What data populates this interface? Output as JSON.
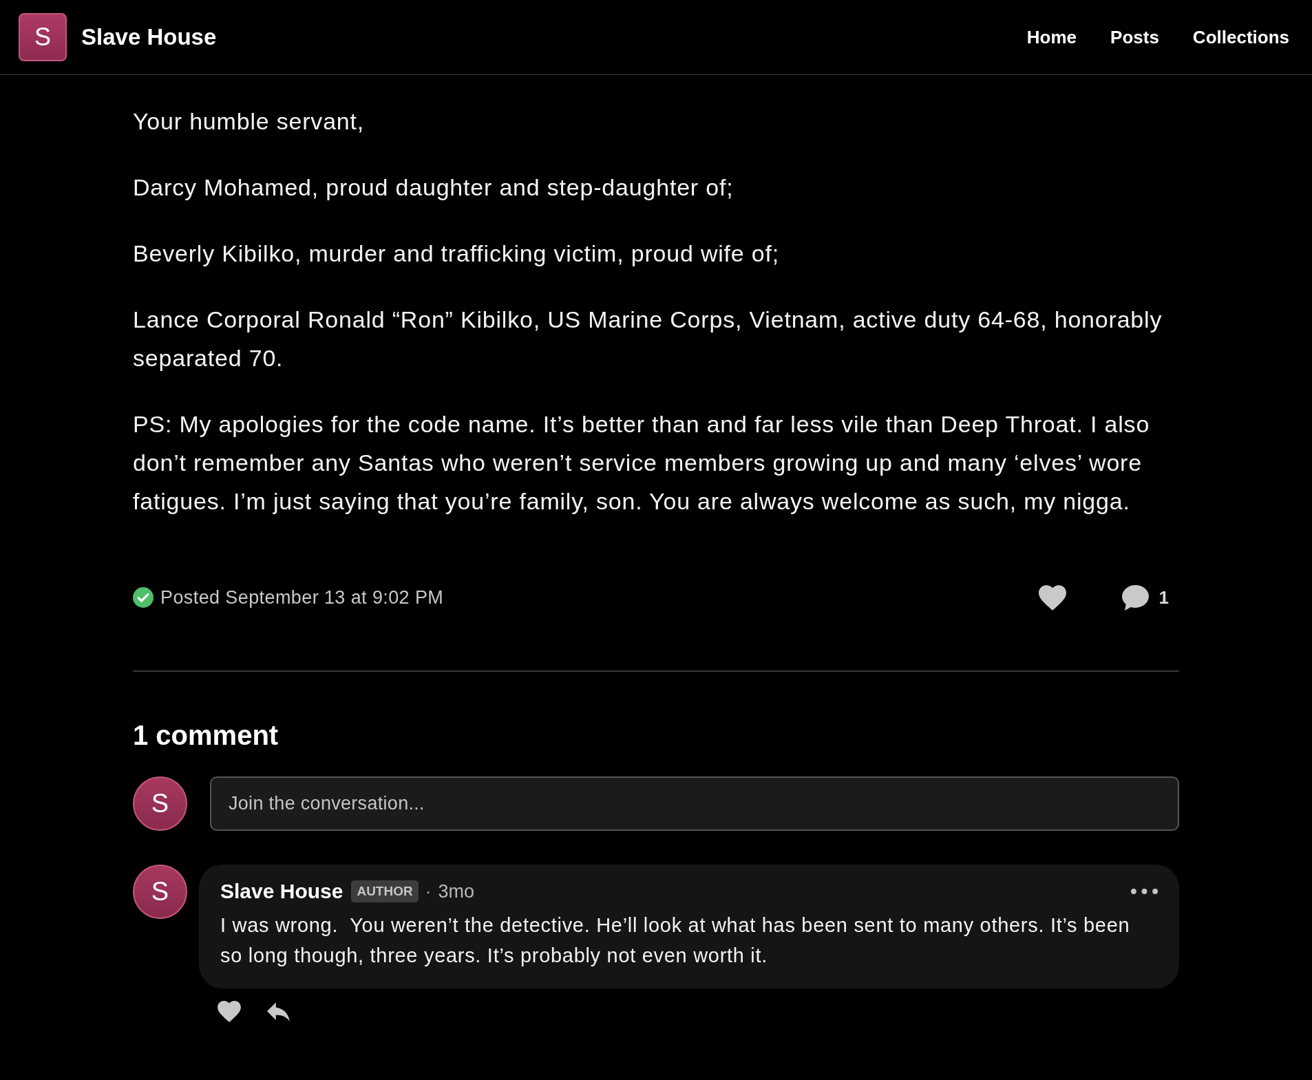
{
  "header": {
    "logo_letter": "S",
    "site_name": "Slave House",
    "nav": [
      {
        "label": "Home"
      },
      {
        "label": "Posts"
      },
      {
        "label": "Collections"
      }
    ]
  },
  "post": {
    "paragraphs": [
      "Your humble servant,",
      "Darcy Mohamed, proud daughter and step-daughter of;",
      "Beverly Kibilko, murder and trafficking victim, proud wife of;",
      "Lance Corporal Ronald “Ron” Kibilko, US Marine Corps, Vietnam, active duty 64-68, honorably separated 70.",
      "PS: My apologies for the code name. It’s better than and far less vile than Deep Throat. I also don’t remember any Santas who weren’t service members growing up and many ‘elves’ wore fatigues. I’m just saying that you’re family, son. You are always welcome as such, my nigga."
    ],
    "posted": "Posted September 13 at 9:02 PM",
    "comment_count": "1"
  },
  "comments_section": {
    "heading": "1 comment",
    "composer": {
      "avatar_letter": "S",
      "placeholder": "Join the conversation..."
    },
    "comments": [
      {
        "avatar_letter": "S",
        "author": "Slave House",
        "badge": "AUTHOR",
        "separator": "·",
        "time": "3mo",
        "text": "I was wrong.  You weren’t the detective. He’ll look at what has been sent to many others. It’s been so long though, three years. It’s probably not even worth it."
      }
    ]
  }
}
